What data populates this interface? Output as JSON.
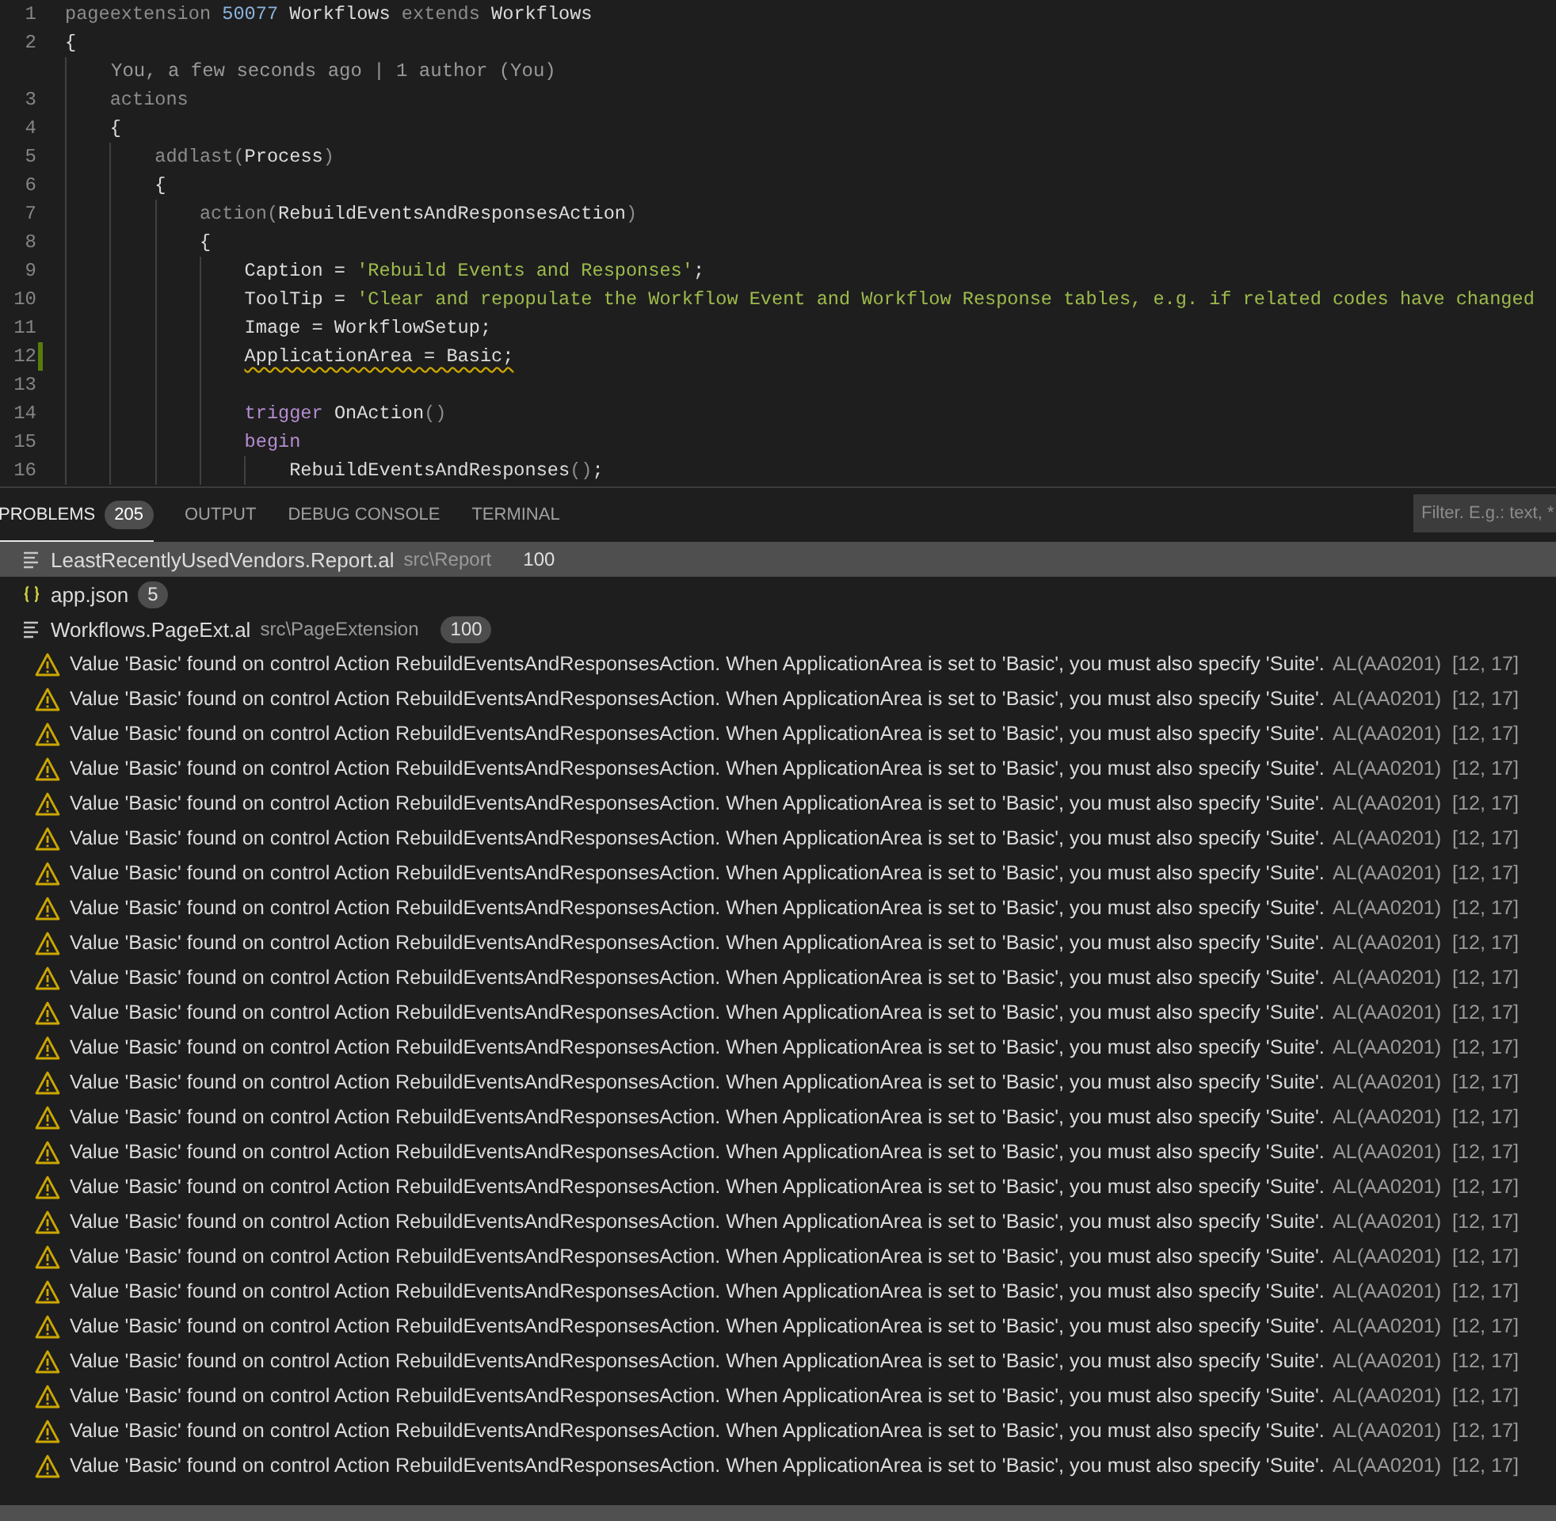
{
  "editor": {
    "lines": [
      {
        "kind": "code",
        "number": "1",
        "modified": false,
        "tokens": [
          {
            "kind": "keyword",
            "text": "pageextension "
          },
          {
            "kind": "number",
            "text": "50077 "
          },
          {
            "kind": "ident",
            "text": "Workflows "
          },
          {
            "kind": "keyword",
            "text": "extends "
          },
          {
            "kind": "ident",
            "text": "Workflows"
          }
        ]
      },
      {
        "kind": "code",
        "number": "2",
        "modified": false,
        "tokens": [
          {
            "kind": "ident",
            "text": "{"
          }
        ]
      },
      {
        "kind": "codelens",
        "text": "You, a few seconds ago | 1 author (You)"
      },
      {
        "kind": "code",
        "number": "3",
        "modified": false,
        "tokens": [
          {
            "kind": "keyword",
            "text": "    actions"
          }
        ]
      },
      {
        "kind": "code",
        "number": "4",
        "modified": false,
        "tokens": [
          {
            "kind": "ident",
            "text": "    {"
          }
        ]
      },
      {
        "kind": "code",
        "number": "5",
        "modified": false,
        "tokens": [
          {
            "kind": "keyword",
            "text": "        addlast"
          },
          {
            "kind": "punct",
            "text": "("
          },
          {
            "kind": "ident",
            "text": "Process"
          },
          {
            "kind": "punct",
            "text": ")"
          }
        ]
      },
      {
        "kind": "code",
        "number": "6",
        "modified": false,
        "tokens": [
          {
            "kind": "ident",
            "text": "        {"
          }
        ]
      },
      {
        "kind": "code",
        "number": "7",
        "modified": false,
        "tokens": [
          {
            "kind": "keyword",
            "text": "            action"
          },
          {
            "kind": "punct",
            "text": "("
          },
          {
            "kind": "ident",
            "text": "RebuildEventsAndResponsesAction"
          },
          {
            "kind": "punct",
            "text": ")"
          }
        ]
      },
      {
        "kind": "code",
        "number": "8",
        "modified": false,
        "tokens": [
          {
            "kind": "ident",
            "text": "            {"
          }
        ]
      },
      {
        "kind": "code",
        "number": "9",
        "modified": false,
        "tokens": [
          {
            "kind": "ident",
            "text": "                Caption = "
          },
          {
            "kind": "string",
            "text": "'Rebuild Events and Responses'"
          },
          {
            "kind": "ident",
            "text": ";"
          }
        ]
      },
      {
        "kind": "code",
        "number": "10",
        "modified": false,
        "tokens": [
          {
            "kind": "ident",
            "text": "                ToolTip = "
          },
          {
            "kind": "string",
            "text": "'Clear and repopulate the Workflow Event and Workflow Response tables, e.g. if related codes have changed"
          }
        ]
      },
      {
        "kind": "code",
        "number": "11",
        "modified": false,
        "tokens": [
          {
            "kind": "ident",
            "text": "                Image = WorkflowSetup;"
          }
        ]
      },
      {
        "kind": "code",
        "number": "12",
        "modified": true,
        "tokens": [
          {
            "kind": "warning",
            "text": "                ApplicationArea = Basic;"
          }
        ]
      },
      {
        "kind": "code",
        "number": "13",
        "modified": false
      },
      {
        "kind": "code",
        "number": "14",
        "modified": false,
        "tokens": [
          {
            "kind": "control",
            "text": "                trigger"
          },
          {
            "kind": "ident",
            "text": " OnAction"
          },
          {
            "kind": "punct",
            "text": "()"
          }
        ]
      },
      {
        "kind": "code",
        "number": "15",
        "modified": false,
        "tokens": [
          {
            "kind": "control",
            "text": "                begin"
          }
        ]
      },
      {
        "kind": "code",
        "number": "16",
        "modified": false,
        "tokens": [
          {
            "kind": "ident",
            "text": "                    RebuildEventsAndResponses"
          },
          {
            "kind": "punct",
            "text": "()"
          },
          {
            "kind": "ident",
            "text": ";"
          }
        ]
      }
    ]
  },
  "panel": {
    "tabs": [
      {
        "label": "PROBLEMS",
        "selected": true,
        "count": "205"
      },
      {
        "label": "OUTPUT",
        "selected": false
      },
      {
        "label": "DEBUG CONSOLE",
        "selected": false
      },
      {
        "label": "TERMINAL",
        "selected": false
      }
    ],
    "filter": {
      "placeholder": "Filter. E.g.: text, *"
    },
    "files": [
      {
        "kind": "al",
        "name": "LeastRecentlyUsedVendors.Report.al",
        "path": "src\\Report",
        "count": "100",
        "selected": true
      },
      {
        "kind": "json",
        "name": "app.json",
        "count": "5",
        "selected": false
      },
      {
        "kind": "al",
        "name": "Workflows.PageExt.al",
        "path": "src\\PageExtension",
        "count": "100",
        "selected": false,
        "problems": [
          {
            "message": "Value 'Basic' found on control Action RebuildEventsAndResponsesAction. When ApplicationArea is set to 'Basic', you must also specify 'Suite'.",
            "code": "AL(AA0201)",
            "position": "[12, 17]"
          },
          {
            "message": "Value 'Basic' found on control Action RebuildEventsAndResponsesAction. When ApplicationArea is set to 'Basic', you must also specify 'Suite'.",
            "code": "AL(AA0201)",
            "position": "[12, 17]"
          },
          {
            "message": "Value 'Basic' found on control Action RebuildEventsAndResponsesAction. When ApplicationArea is set to 'Basic', you must also specify 'Suite'.",
            "code": "AL(AA0201)",
            "position": "[12, 17]"
          },
          {
            "message": "Value 'Basic' found on control Action RebuildEventsAndResponsesAction. When ApplicationArea is set to 'Basic', you must also specify 'Suite'.",
            "code": "AL(AA0201)",
            "position": "[12, 17]"
          },
          {
            "message": "Value 'Basic' found on control Action RebuildEventsAndResponsesAction. When ApplicationArea is set to 'Basic', you must also specify 'Suite'.",
            "code": "AL(AA0201)",
            "position": "[12, 17]"
          },
          {
            "message": "Value 'Basic' found on control Action RebuildEventsAndResponsesAction. When ApplicationArea is set to 'Basic', you must also specify 'Suite'.",
            "code": "AL(AA0201)",
            "position": "[12, 17]"
          },
          {
            "message": "Value 'Basic' found on control Action RebuildEventsAndResponsesAction. When ApplicationArea is set to 'Basic', you must also specify 'Suite'.",
            "code": "AL(AA0201)",
            "position": "[12, 17]"
          },
          {
            "message": "Value 'Basic' found on control Action RebuildEventsAndResponsesAction. When ApplicationArea is set to 'Basic', you must also specify 'Suite'.",
            "code": "AL(AA0201)",
            "position": "[12, 17]"
          },
          {
            "message": "Value 'Basic' found on control Action RebuildEventsAndResponsesAction. When ApplicationArea is set to 'Basic', you must also specify 'Suite'.",
            "code": "AL(AA0201)",
            "position": "[12, 17]"
          },
          {
            "message": "Value 'Basic' found on control Action RebuildEventsAndResponsesAction. When ApplicationArea is set to 'Basic', you must also specify 'Suite'.",
            "code": "AL(AA0201)",
            "position": "[12, 17]"
          },
          {
            "message": "Value 'Basic' found on control Action RebuildEventsAndResponsesAction. When ApplicationArea is set to 'Basic', you must also specify 'Suite'.",
            "code": "AL(AA0201)",
            "position": "[12, 17]"
          },
          {
            "message": "Value 'Basic' found on control Action RebuildEventsAndResponsesAction. When ApplicationArea is set to 'Basic', you must also specify 'Suite'.",
            "code": "AL(AA0201)",
            "position": "[12, 17]"
          },
          {
            "message": "Value 'Basic' found on control Action RebuildEventsAndResponsesAction. When ApplicationArea is set to 'Basic', you must also specify 'Suite'.",
            "code": "AL(AA0201)",
            "position": "[12, 17]"
          },
          {
            "message": "Value 'Basic' found on control Action RebuildEventsAndResponsesAction. When ApplicationArea is set to 'Basic', you must also specify 'Suite'.",
            "code": "AL(AA0201)",
            "position": "[12, 17]"
          },
          {
            "message": "Value 'Basic' found on control Action RebuildEventsAndResponsesAction. When ApplicationArea is set to 'Basic', you must also specify 'Suite'.",
            "code": "AL(AA0201)",
            "position": "[12, 17]"
          },
          {
            "message": "Value 'Basic' found on control Action RebuildEventsAndResponsesAction. When ApplicationArea is set to 'Basic', you must also specify 'Suite'.",
            "code": "AL(AA0201)",
            "position": "[12, 17]"
          },
          {
            "message": "Value 'Basic' found on control Action RebuildEventsAndResponsesAction. When ApplicationArea is set to 'Basic', you must also specify 'Suite'.",
            "code": "AL(AA0201)",
            "position": "[12, 17]"
          },
          {
            "message": "Value 'Basic' found on control Action RebuildEventsAndResponsesAction. When ApplicationArea is set to 'Basic', you must also specify 'Suite'.",
            "code": "AL(AA0201)",
            "position": "[12, 17]"
          },
          {
            "message": "Value 'Basic' found on control Action RebuildEventsAndResponsesAction. When ApplicationArea is set to 'Basic', you must also specify 'Suite'.",
            "code": "AL(AA0201)",
            "position": "[12, 17]"
          },
          {
            "message": "Value 'Basic' found on control Action RebuildEventsAndResponsesAction. When ApplicationArea is set to 'Basic', you must also specify 'Suite'.",
            "code": "AL(AA0201)",
            "position": "[12, 17]"
          },
          {
            "message": "Value 'Basic' found on control Action RebuildEventsAndResponsesAction. When ApplicationArea is set to 'Basic', you must also specify 'Suite'.",
            "code": "AL(AA0201)",
            "position": "[12, 17]"
          },
          {
            "message": "Value 'Basic' found on control Action RebuildEventsAndResponsesAction. When ApplicationArea is set to 'Basic', you must also specify 'Suite'.",
            "code": "AL(AA0201)",
            "position": "[12, 17]"
          },
          {
            "message": "Value 'Basic' found on control Action RebuildEventsAndResponsesAction. When ApplicationArea is set to 'Basic', you must also specify 'Suite'.",
            "code": "AL(AA0201)",
            "position": "[12, 17]"
          },
          {
            "message": "Value 'Basic' found on control Action RebuildEventsAndResponsesAction. When ApplicationArea is set to 'Basic', you must also specify 'Suite'.",
            "code": "AL(AA0201)",
            "position": "[12, 17]"
          }
        ]
      }
    ]
  }
}
